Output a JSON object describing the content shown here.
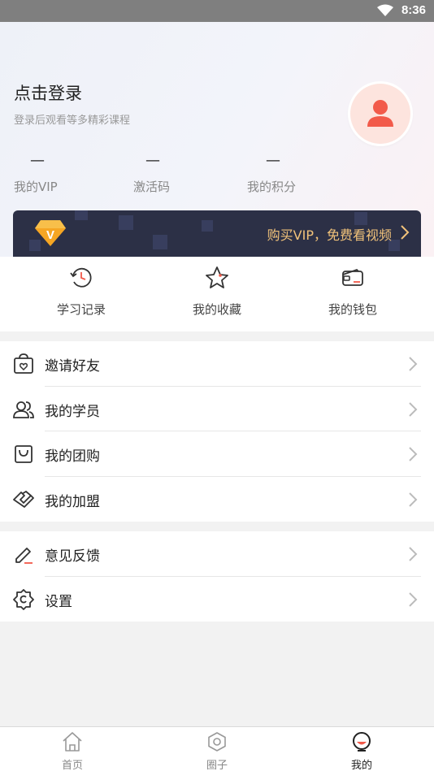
{
  "status_bar": {
    "time": "8:36"
  },
  "header": {
    "login_title": "点击登录",
    "login_subtitle": "登录后观看等多精彩课程",
    "stats": [
      {
        "value": "—",
        "label": "我的VIP"
      },
      {
        "value": "—",
        "label": "激活码"
      },
      {
        "value": "—",
        "label": "我的积分"
      }
    ],
    "vip_banner_text": "购买VIP，免费看视频",
    "vip_badge_letter": "V"
  },
  "quick_actions": [
    {
      "label": "学习记录",
      "icon": "history-icon"
    },
    {
      "label": "我的收藏",
      "icon": "star-icon"
    },
    {
      "label": "我的钱包",
      "icon": "wallet-icon"
    }
  ],
  "menu_group_1": [
    {
      "label": "邀请好友",
      "icon": "gift-bag-icon"
    },
    {
      "label": "我的学员",
      "icon": "users-icon"
    },
    {
      "label": "我的团购",
      "icon": "shopping-bag-icon"
    },
    {
      "label": "我的加盟",
      "icon": "handshake-icon"
    }
  ],
  "menu_group_2": [
    {
      "label": "意见反馈",
      "icon": "edit-icon"
    },
    {
      "label": "设置",
      "icon": "settings-icon"
    }
  ],
  "tabbar": [
    {
      "label": "首页",
      "icon": "home-icon"
    },
    {
      "label": "圈子",
      "icon": "hexagon-icon"
    },
    {
      "label": "我的",
      "icon": "profile-icon",
      "active": true
    }
  ],
  "colors": {
    "accent": "#f25a4a",
    "vip_gold": "#f1c27a",
    "banner_bg": "#2c3046"
  }
}
